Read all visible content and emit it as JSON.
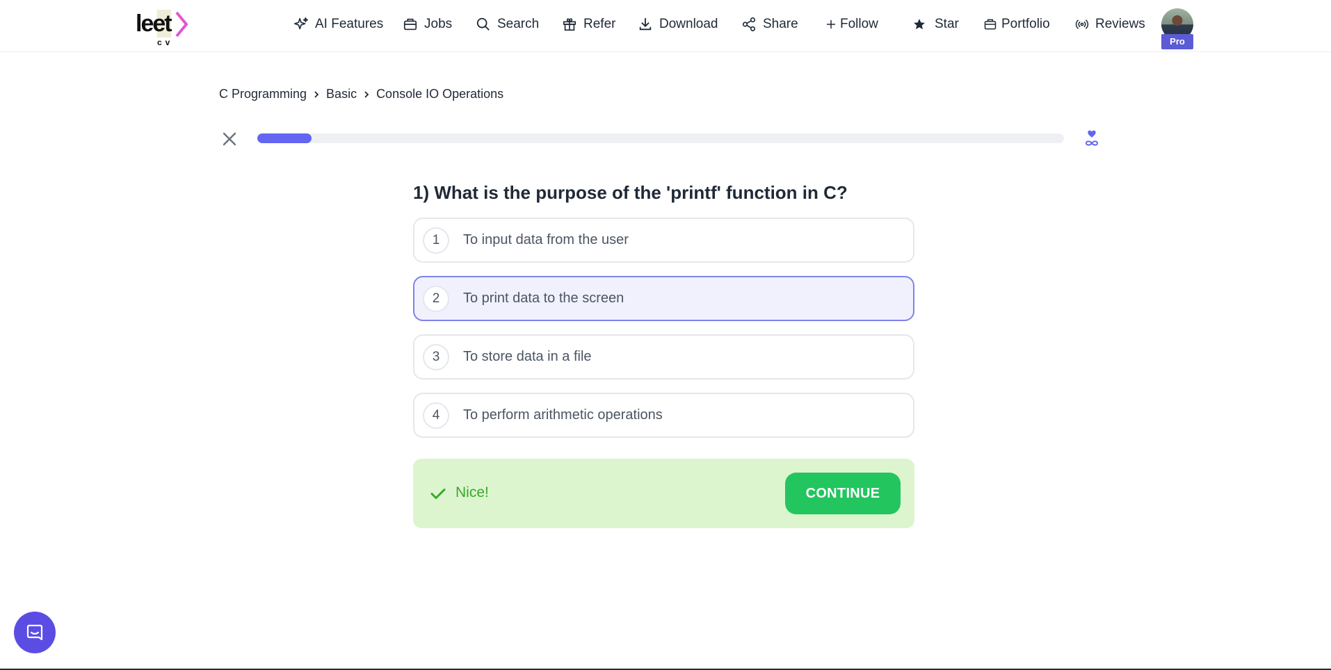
{
  "logo": {
    "word": "leet",
    "sub": "cv"
  },
  "nav": [
    {
      "id": "ai-features",
      "label": "AI Features",
      "icon": "sparkle-icon"
    },
    {
      "id": "jobs",
      "label": "Jobs",
      "icon": "briefcase-icon"
    },
    {
      "id": "search",
      "label": "Search",
      "icon": "search-icon"
    },
    {
      "id": "refer",
      "label": "Refer",
      "icon": "gift-icon"
    },
    {
      "id": "download",
      "label": "Download",
      "icon": "download-icon"
    },
    {
      "id": "share",
      "label": "Share",
      "icon": "share-icon"
    },
    {
      "id": "follow",
      "label": "Follow",
      "icon": "plus-icon"
    },
    {
      "id": "star",
      "label": "Star",
      "icon": "star-icon"
    },
    {
      "id": "portfolio",
      "label": "Portfolio",
      "icon": "portfolio-icon"
    },
    {
      "id": "reviews",
      "label": "Reviews",
      "icon": "broadcast-icon"
    }
  ],
  "user": {
    "badge": "Pro"
  },
  "breadcrumb": [
    "C Programming",
    "Basic",
    "Console IO Operations"
  ],
  "progress": {
    "fraction": 0.067
  },
  "quiz": {
    "question": "1) What is the purpose of the 'printf' function in C?",
    "options": [
      {
        "number": "1",
        "text": "To input data from the user"
      },
      {
        "number": "2",
        "text": "To print data to the screen"
      },
      {
        "number": "3",
        "text": "To store data in a file"
      },
      {
        "number": "4",
        "text": "To perform arithmetic operations"
      }
    ],
    "selected_index": 1
  },
  "feedback": {
    "message": "Nice!",
    "button_label": "CONTINUE"
  },
  "colors": {
    "accent": "#6366f1",
    "success": "#22c55e",
    "success_bg": "#dcf5cf",
    "logo_arrow": "#e255d6"
  }
}
